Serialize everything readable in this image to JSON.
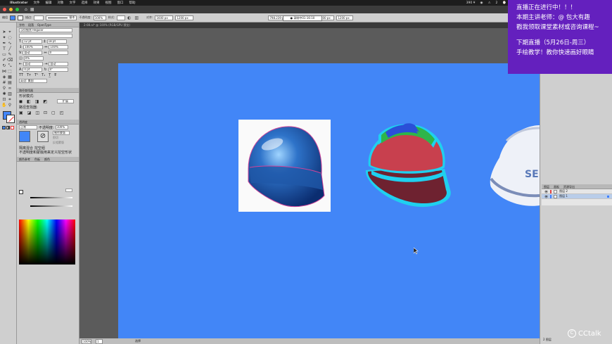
{
  "menubar": {
    "apple": "",
    "items": [
      "Illustrator",
      "文件",
      "编辑",
      "对象",
      "文字",
      "选择",
      "效果",
      "视图",
      "窗口",
      "帮助"
    ],
    "right": [
      "390 ¥",
      "◉",
      "⚠",
      "2",
      "⌚"
    ]
  },
  "control": {
    "left_label": "编组",
    "stroke_label": "描边:",
    "stroke_style": "基本",
    "opacity_label": "不透明度:",
    "opacity_value": "100%",
    "style_label": "样式:",
    "width_value": "1600 px",
    "height_value": "1200 px",
    "x_value": "798.239 p",
    "y_value": "600 px",
    "w_value": "1600 px",
    "h_value": "1200 px",
    "align_label": "对齐:"
  },
  "timer": {
    "text": "● 录制中01:16:10"
  },
  "document": {
    "tab": "2-08.ai* @ 100% (RGB/GPU 预览)"
  },
  "character": {
    "tab_char": "字符",
    "tab_para": "段落",
    "tab_open": "OpenType",
    "font": "汉仪细黑 Regular",
    "font_style": "",
    "size": "12 pt",
    "leading": "18 pt",
    "vscale": "100%",
    "hscale": "100%",
    "kerning": "自动",
    "tracking": "0",
    "tsume": "0%",
    "aki_left": "自动",
    "aki_right": "自动",
    "baseline": "0 pt",
    "rotate": "0°",
    "lang": "英语: 美国",
    "pathfinder_tab": "路径查找器",
    "shape_modes": "形状模式:",
    "pathfinder": "路径查找器:",
    "expand": "扩展",
    "transparency_tab": "透明度",
    "blend": "正常",
    "opacity_label": "不透明度:",
    "opacity": "100%",
    "mask_btn": "制作蒙版",
    "clip": "剪切",
    "invert": "反相蒙版",
    "isolate": "隔离混合",
    "knockout": "挖空组",
    "opacity_mask": "不透明度和蒙版用来定义挖空形状",
    "color_tabs": [
      "颜色参考",
      "色板",
      "颜色"
    ]
  },
  "layers": {
    "tabs": [
      "图层",
      "画板",
      "资源导出"
    ],
    "rows": [
      {
        "name": "图层 2",
        "color": "#e04040"
      },
      {
        "name": "图层 1",
        "color": "#3f7fff"
      }
    ],
    "footer": "2 图层"
  },
  "status": {
    "zoom": "100%",
    "page": "1",
    "mode": "选择"
  },
  "banner": {
    "lines": [
      "直播正在进行中！！！",
      "本期主讲老师：@ 包大有趣",
      "戳我领取课堂素材或咨询课程~",
      "",
      "下期直播（5月26日-周三）",
      "手绘教学！教你快速画好眼睛"
    ],
    "color": "#6420be"
  },
  "logo": {
    "text": "CCtalk"
  },
  "art": {
    "artboard_color": "#4286f7",
    "helmet_red": "#c8404e",
    "helmet_dark": "#6e2230",
    "outline_cyan": "#1fd0ef",
    "partial_text": "SE"
  }
}
